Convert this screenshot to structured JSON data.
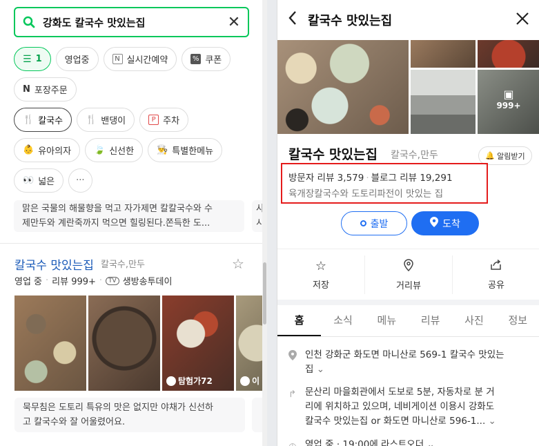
{
  "search": {
    "query": "강화도 칼국수 맛있는집"
  },
  "filters": {
    "row1": [
      {
        "label": "1",
        "icon": "filter-icon",
        "active": true
      },
      {
        "label": "영업중"
      },
      {
        "label": "실시간예약",
        "icon": "calendar-icon"
      },
      {
        "label": "쿠폰",
        "icon": "coupon-icon"
      }
    ],
    "row2": [
      {
        "label": "포장주문",
        "icon": "naver-n-icon"
      }
    ],
    "row3": [
      {
        "label": "칼국수",
        "icon": "utensils-icon",
        "selected": true
      },
      {
        "label": "밴댕이",
        "icon": "utensils-icon"
      },
      {
        "label": "주차",
        "icon": "parking-icon"
      }
    ],
    "row4": [
      {
        "label": "유아의자",
        "icon": "baby-emoji"
      },
      {
        "label": "신선한",
        "icon": "leaf-emoji"
      },
      {
        "label": "특별한메뉴",
        "icon": "chef-emoji"
      }
    ],
    "row5": [
      {
        "label": "넓은",
        "icon": "eyes-emoji"
      },
      {
        "label": "···"
      }
    ]
  },
  "prev_result": {
    "snippet_line1": "맑은 국물의 해물향을 먹고 자가제면 칼칼국수와 수",
    "snippet_line2": "제만두와 계란죽까지 먹으면 힐링된다.쫀득한 도...",
    "side_line1": "사",
    "side_line2": "시"
  },
  "result": {
    "title": "칼국수 맛있는집",
    "category": "칼국수,만두",
    "status": "영업 중",
    "reviews": "리뷰 999+",
    "tv_badge": "TV",
    "tv_show": "생방송투데이",
    "photo_badge": "탐험가72",
    "photo_badge2": "이",
    "snippet_line1": "묵무침은 도토리 특유의 맛은 없지만 야채가 신선하",
    "snippet_line2": "고 칼국수와 잘 어울렸어요."
  },
  "detail": {
    "header_title": "칼국수 맛있는집",
    "more_photos": "999+",
    "name": "칼국수 맛있는집",
    "category": "칼국수,만두",
    "notify_label": "알림받기",
    "visitor_reviews": "방문자 리뷰 3,579",
    "blog_reviews": "블로그 리뷰 19,291",
    "description": "육개장칼국수와 도토리파전이 맛있는 집",
    "depart_label": "출발",
    "arrive_label": "도착",
    "actions": [
      {
        "label": "저장",
        "icon": "star-icon"
      },
      {
        "label": "거리뷰",
        "icon": "location-pin-icon"
      },
      {
        "label": "공유",
        "icon": "share-icon"
      }
    ],
    "tabs": [
      "홈",
      "소식",
      "메뉴",
      "리뷰",
      "사진",
      "정보"
    ],
    "address_line1": "인천 강화군 화도면 마니산로 569-1 칼국수 맛있는",
    "address_line2": "집",
    "directions_line1": "문산리 마을회관에서 도보로 5분, 자동차로 분 거",
    "directions_line2": "리에 위치하고 있으며, 네비게이션 이용시 강화도",
    "directions_line3": "칼국수 맛있는집 or 화도면 마니산로 596-1...",
    "hours": "영업 중 · 19:00에 라스트오더",
    "highlight_color": "#e41b1b",
    "accent_green": "#03c75a",
    "accent_blue": "#1f6ef2"
  }
}
